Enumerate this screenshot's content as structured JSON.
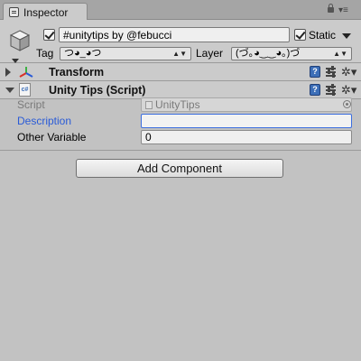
{
  "window": {
    "tab_label": "Inspector"
  },
  "game_object": {
    "name": "#unitytips by @febucci",
    "static_label": "Static",
    "tag_label": "Tag",
    "tag_value": "つ◕_◕つ",
    "layer_label": "Layer",
    "layer_value": "(づ｡◕‿‿◕｡)づ"
  },
  "components": [
    {
      "title": "Transform",
      "expanded": false
    },
    {
      "title": "Unity Tips (Script)",
      "expanded": true,
      "icon_text": "c#",
      "properties": [
        {
          "label": "Script",
          "value": "UnityTips"
        },
        {
          "label": "Description",
          "value": ""
        },
        {
          "label": "Other Variable",
          "value": "0"
        }
      ]
    }
  ],
  "add_component_label": "Add Component",
  "icons": [
    "inspector-tab-icon",
    "lock-icon",
    "menu-icon",
    "gameobject-cube-icon",
    "reference-icon",
    "preset-icon",
    "gear-icon",
    "transform-axes-icon",
    "csharp-script-icon",
    "object-picker-icon"
  ],
  "colors": {
    "panel": "#c2c2c2",
    "header": "#cbcbcb",
    "focus_blue": "#2a5bd7",
    "field": "#efefef"
  }
}
